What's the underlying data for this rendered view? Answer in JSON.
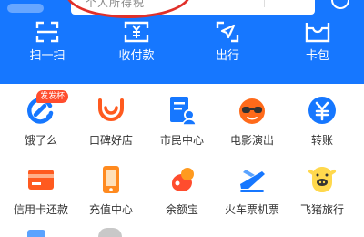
{
  "search": {
    "placeholder": "个人所得税"
  },
  "colors": {
    "brand_blue": "#1677ff",
    "highlight_ring": "#e0302a",
    "badge_red": "#ff4d2e"
  },
  "quick_actions": [
    {
      "label": "扫一扫",
      "icon": "scan-icon"
    },
    {
      "label": "收付款",
      "icon": "payment-code-icon"
    },
    {
      "label": "出行",
      "icon": "travel-icon"
    },
    {
      "label": "卡包",
      "icon": "card-wallet-icon"
    }
  ],
  "apps_row1": [
    {
      "label": "饿了么",
      "icon": "eleme-icon",
      "badge": "发发杯"
    },
    {
      "label": "口碑好店",
      "icon": "koubei-icon"
    },
    {
      "label": "市民中心",
      "icon": "citizen-center-icon"
    },
    {
      "label": "电影演出",
      "icon": "movie-icon"
    },
    {
      "label": "转账",
      "icon": "transfer-icon"
    }
  ],
  "apps_row2": [
    {
      "label": "信用卡还款",
      "icon": "credit-card-icon"
    },
    {
      "label": "充值中心",
      "icon": "phone-recharge-icon"
    },
    {
      "label": "余额宝",
      "icon": "yuebao-icon"
    },
    {
      "label": "火车票机票",
      "icon": "train-plane-ticket-icon"
    },
    {
      "label": "飞猪旅行",
      "icon": "fliggy-icon"
    }
  ]
}
